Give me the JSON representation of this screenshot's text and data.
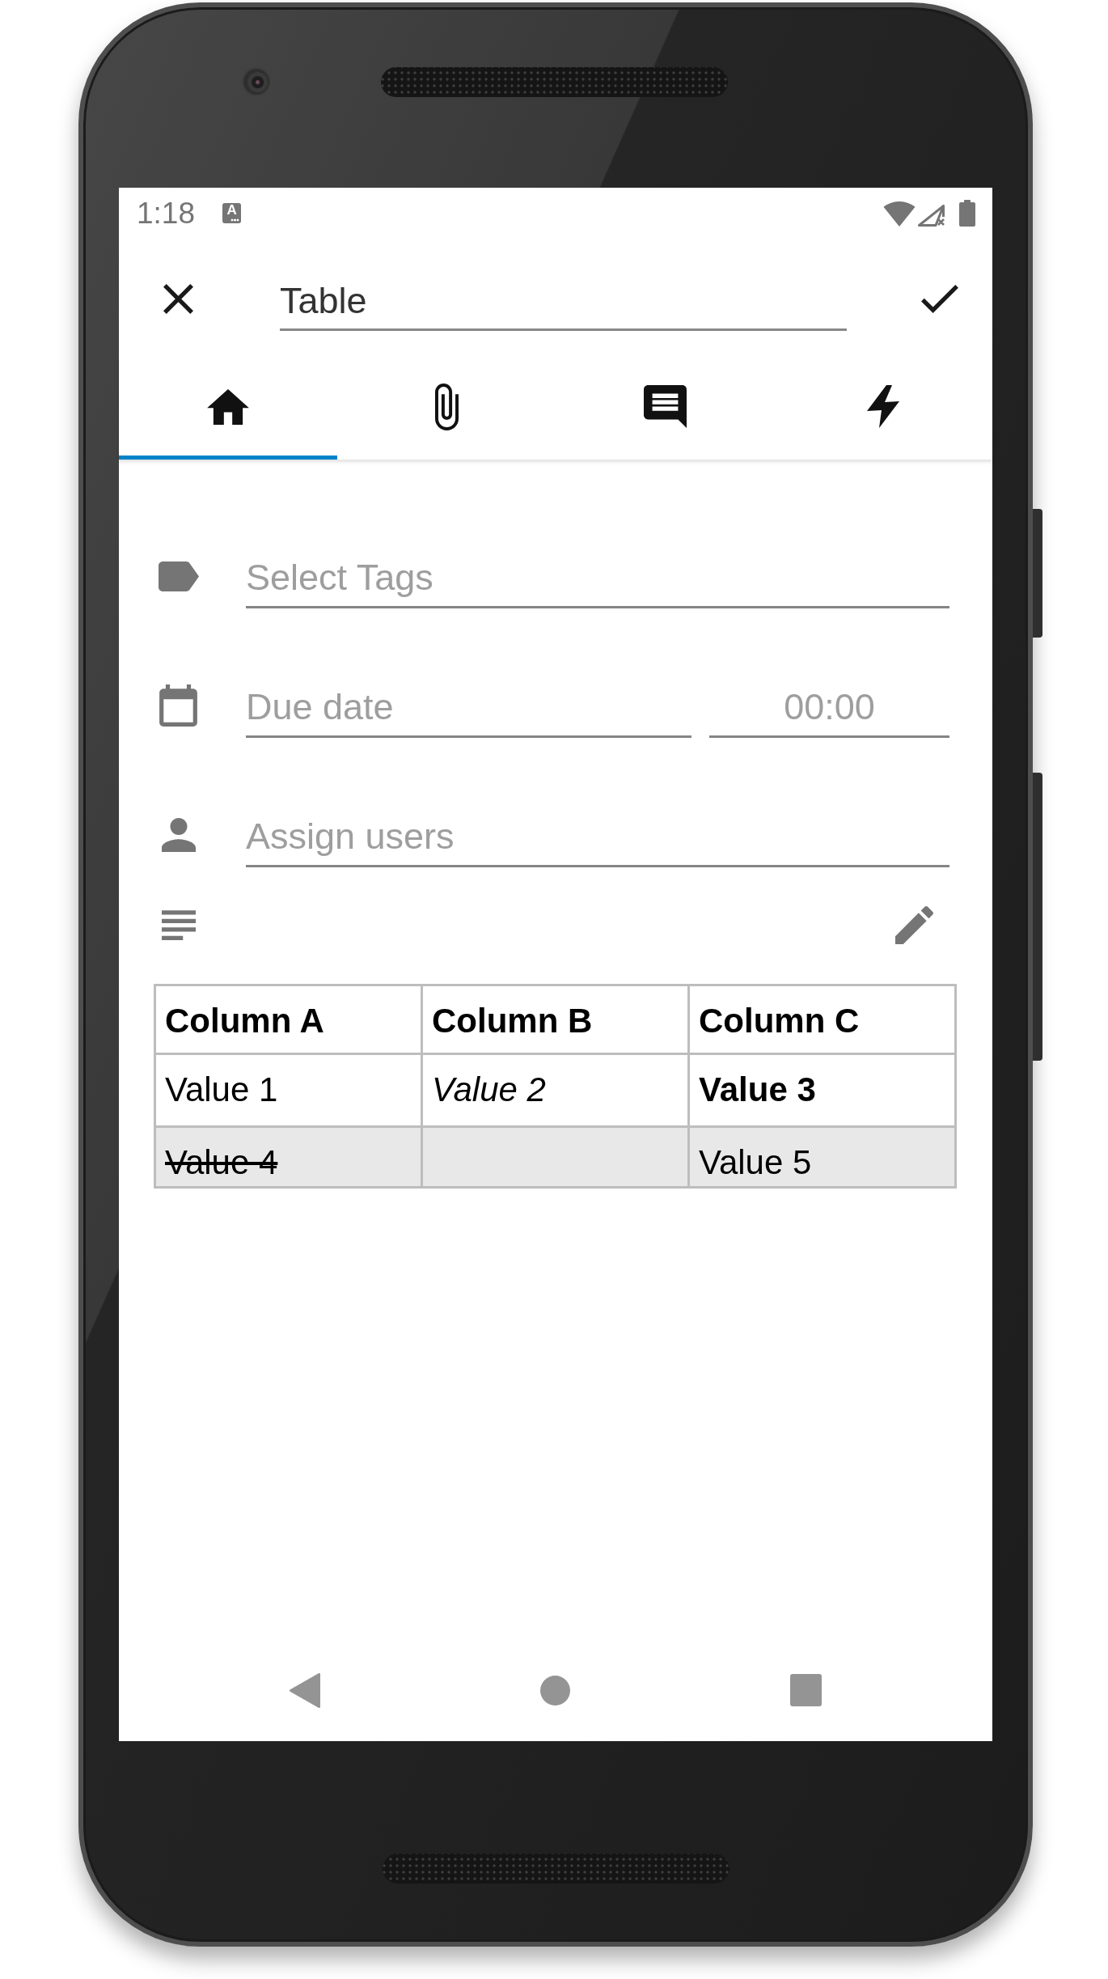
{
  "status_bar": {
    "time": "1:18",
    "notification_icons": [
      "A"
    ]
  },
  "app_bar": {
    "title_field": {
      "value": "Table"
    }
  },
  "tabs": [
    {
      "kind": "home",
      "selected": true
    },
    {
      "kind": "attachments",
      "selected": false
    },
    {
      "kind": "comments",
      "selected": false
    },
    {
      "kind": "activity",
      "selected": false
    }
  ],
  "form": {
    "rows": [
      {
        "kind": "tags",
        "fields": [
          {
            "placeholder": "Select Tags"
          }
        ]
      },
      {
        "kind": "date",
        "fields": [
          {
            "placeholder": "Due date"
          },
          {
            "placeholder": "00:00"
          }
        ]
      },
      {
        "kind": "users",
        "fields": [
          {
            "placeholder": "Assign users"
          }
        ]
      }
    ]
  },
  "description": {
    "table": {
      "columns": [
        "Column A",
        "Column B",
        "Column C"
      ],
      "rows": [
        {
          "shaded": false,
          "cells": [
            {
              "text": "Value 1"
            },
            {
              "text": "Value 2",
              "kind": "italic"
            },
            {
              "text": "Value 3",
              "kind": "bold"
            }
          ]
        },
        {
          "shaded": true,
          "cells": [
            {
              "text": "Value 4",
              "kind": "strikethrough"
            },
            {},
            {
              "text": "Value 5"
            }
          ]
        }
      ]
    }
  }
}
